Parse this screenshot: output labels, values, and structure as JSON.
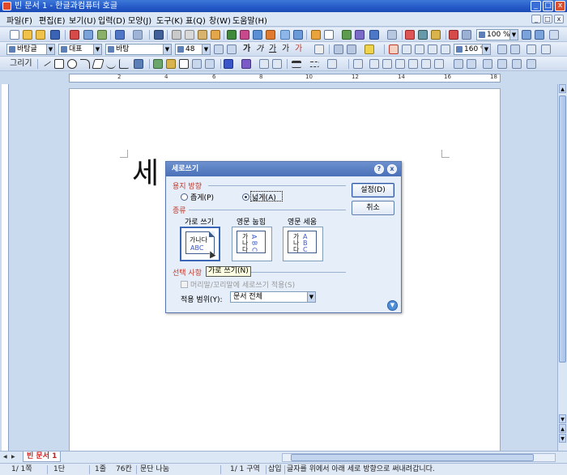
{
  "window": {
    "title": "빈 문서 1 - 한글과컴퓨터 호글",
    "min": "_",
    "max": "□",
    "close": "x"
  },
  "menu": {
    "items": [
      "파일(F)",
      "편집(E)",
      "보기(U)",
      "입력(D)",
      "모양(J)",
      "도구(K)",
      "표(Q)",
      "창(W)",
      "도움말(H)"
    ],
    "doc_controls": [
      "_",
      "□",
      "x"
    ]
  },
  "toolbar": {
    "zoom": "100 %",
    "style": "바탕글",
    "font_lang": "대표",
    "font_name": "바탕",
    "font_size": "48",
    "line_spacing": "160 %",
    "text_glyphs": [
      "가",
      "가",
      "가",
      "가",
      "가"
    ],
    "draw_label": "그리기"
  },
  "ruler": {
    "numbers": [
      "2",
      "4",
      "6",
      "8",
      "10",
      "12",
      "14",
      "16",
      "18"
    ]
  },
  "document": {
    "text": "세"
  },
  "dialog": {
    "title": "세로쓰기",
    "orientation_group": "용지 방향",
    "portrait": "좁게(P)",
    "landscape": "넓게(A)",
    "selected_orientation": "넓게(A)",
    "type_group": "종류",
    "options": [
      {
        "caption": "가로 쓰기",
        "line1": "가나다",
        "line2": "ABC",
        "selected": true
      },
      {
        "caption": "영문 눕힘",
        "col1": [
          "가",
          "나",
          "다"
        ],
        "col2": [
          "A",
          "B",
          "C"
        ],
        "selected": false
      },
      {
        "caption": "영문 세움",
        "col1": [
          "가",
          "나",
          "다"
        ],
        "col2": [
          "A",
          "B",
          "C"
        ],
        "selected": false
      }
    ],
    "tooltip": "가로 쓰기(N)",
    "selection_group": "선택 사항",
    "header_footer_checkbox": "머리말/꼬리말에 세로쓰기 적용(S)",
    "scope_label": "적용 범위(Y):",
    "scope_value": "문서 전체",
    "ok": "설정(D)",
    "cancel": "취소",
    "help": "?",
    "close": "x"
  },
  "tabs": {
    "active": "빈 문서 1"
  },
  "status": {
    "page": "1/ 1쪽",
    "section": "1단",
    "line": "1줄",
    "column": "76칸",
    "paragraph": "문단 나눔",
    "pos": "1/ 1 구역",
    "mode": "삽입",
    "message": "글자를 위에서 아래 세로 방향으로 써내려갑니다."
  }
}
